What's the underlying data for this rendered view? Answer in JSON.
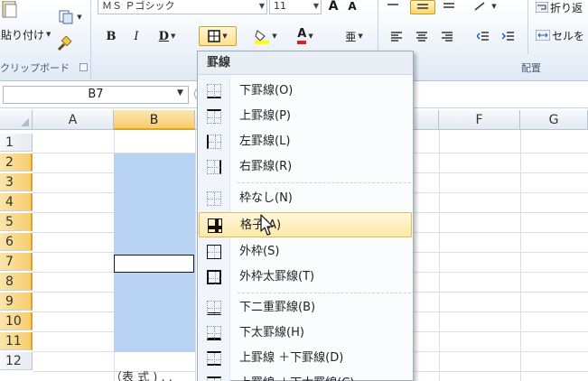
{
  "ribbon": {
    "font_name": "ＭＳ Ｐゴシック",
    "font_size": "11",
    "paste_label": "貼り付け",
    "clipboard_label": "クリップボード",
    "alignment_label": "配置",
    "wrap_text_label": "折り返",
    "merge_label": "セルを"
  },
  "formula_bar": {
    "name_box": "B7"
  },
  "grid": {
    "columns": [
      "A",
      "B",
      "C",
      "D",
      "E",
      "F",
      "G"
    ],
    "rows": [
      "1",
      "2",
      "3",
      "4",
      "5",
      "6",
      "7",
      "8",
      "9",
      "10",
      "11",
      "12"
    ],
    "selected_column": "B",
    "active_cell": "B7",
    "bottom_text": "（表 式 ) . ."
  },
  "border_menu": {
    "title": "罫線",
    "items": [
      {
        "label": "下罫線(O)",
        "icon": "bottom-border-icon"
      },
      {
        "label": "上罫線(P)",
        "icon": "top-border-icon"
      },
      {
        "label": "左罫線(L)",
        "icon": "left-border-icon"
      },
      {
        "label": "右罫線(R)",
        "icon": "right-border-icon"
      },
      {
        "label": "枠なし(N)",
        "icon": "no-border-icon"
      },
      {
        "label": "格子(A)",
        "icon": "all-borders-icon",
        "highlighted": true
      },
      {
        "label": "外枠(S)",
        "icon": "outside-border-icon"
      },
      {
        "label": "外枠太罫線(T)",
        "icon": "thick-outside-border-icon"
      },
      {
        "label": "下二重罫線(B)",
        "icon": "double-bottom-border-icon"
      },
      {
        "label": "下太罫線(H)",
        "icon": "thick-bottom-border-icon"
      },
      {
        "label": "上罫線 ＋下罫線(D)",
        "icon": "top-bottom-border-icon"
      },
      {
        "label": "上罫線 ＋下太罫線(C)",
        "icon": "top-thick-bottom-border-icon"
      }
    ]
  },
  "colors": {
    "selection_fill": "#b8d3f2",
    "header_highlight": "#f6cc6a",
    "menu_highlight": "#fde9a8"
  }
}
